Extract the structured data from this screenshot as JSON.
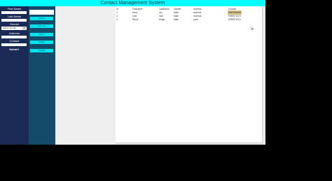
{
  "window": {
    "title": "Contact Management System"
  },
  "form": {
    "first_name_label": "First Name",
    "last_name_label": "Last Name",
    "gender_label": "Gender",
    "gender_value": "Select Gender",
    "address_label": "Address",
    "contact_label": "Contact",
    "submit_label": "Submit"
  },
  "actions": {
    "search_label": "Search",
    "view_all_label": "View All",
    "reset_label": "Reset",
    "delete_label": "Delete",
    "update_label": "Update"
  },
  "table": {
    "columns": [
      "id",
      "FirstName",
      "LastName",
      "Gender",
      "Address",
      "Contact"
    ],
    "rows": [
      [
        "1",
        "rahul",
        "rao",
        "Male",
        "mumbai",
        "9999999999"
      ],
      [
        "3",
        "rohit",
        "rival",
        "Male",
        "mumbai",
        "9789971023"
      ],
      [
        "4",
        "Rahul",
        "Singh",
        "Male",
        "pune",
        "8789971023"
      ]
    ]
  },
  "colors": {
    "title_bg": "#00ffff",
    "form_panel": "#1a2a55",
    "action_panel": "#144a6a",
    "button": "#00e5ee"
  }
}
